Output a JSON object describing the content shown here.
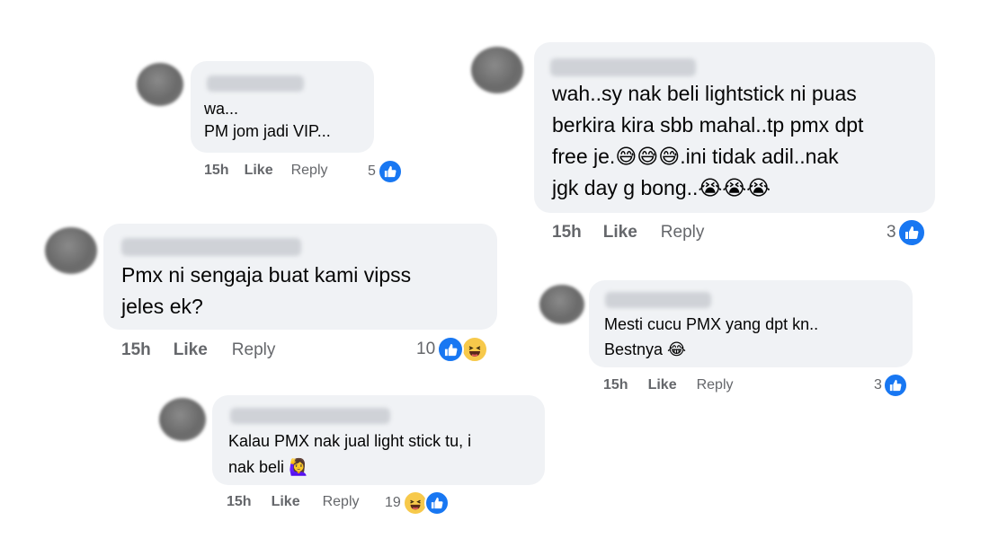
{
  "comments": [
    {
      "text": "wa...\nPM jom jadi VIP...",
      "time": "15h",
      "like": "Like",
      "reply": "Reply",
      "count": "5",
      "reactions": [
        "like-icon"
      ]
    },
    {
      "text": "wah..sy nak beli lightstick ni puas\nberkira kira sbb mahal..tp pmx dpt\nfree je.😅😅😅.ini tidak adil..nak\njgk day g bong..😭😭😭",
      "time": "15h",
      "like": "Like",
      "reply": "Reply",
      "count": "3",
      "reactions": [
        "like-icon"
      ]
    },
    {
      "text": "Pmx ni sengaja buat kami vipss\njeles ek?",
      "time": "15h",
      "like": "Like",
      "reply": "Reply",
      "count": "10",
      "reactions": [
        "like-icon",
        "haha-icon"
      ]
    },
    {
      "text": "Mesti cucu PMX yang dpt kn..\nBestnya 😂",
      "time": "15h",
      "like": "Like",
      "reply": "Reply",
      "count": "3",
      "reactions": [
        "like-icon"
      ]
    },
    {
      "text": "Kalau PMX nak jual light stick tu, i\nnak beli 🙋‍♀️",
      "time": "15h",
      "like": "Like",
      "reply": "Reply",
      "count": "19",
      "reactions": [
        "haha-icon",
        "like-icon"
      ]
    }
  ],
  "colors": {
    "bubble": "#f0f2f5",
    "like_blue": "#1877f2",
    "meta_gray": "#65676b"
  }
}
